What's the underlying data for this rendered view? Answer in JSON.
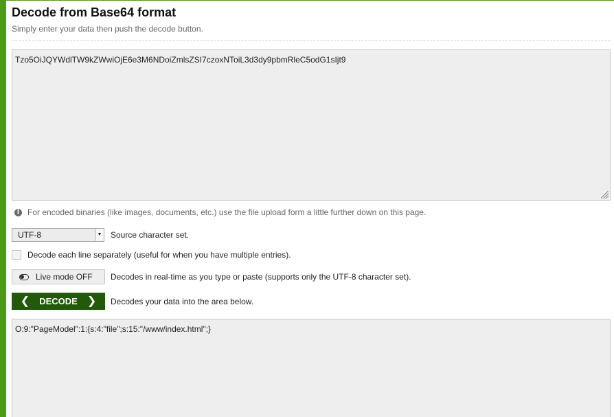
{
  "header": {
    "title": "Decode from Base64 format",
    "subtitle": "Simply enter your data then push the decode button."
  },
  "input": {
    "value": "Tzo5OiJQYWdlTW9kZWwiOjE6e3M6NDoiZmlsZSI7czoxNToiL3d3dy9pbmRleC5odG1sIjt9"
  },
  "info": {
    "text": "For encoded binaries (like images, documents, etc.) use the file upload form a little further down on this page."
  },
  "charset": {
    "selected": "UTF-8",
    "label": "Source character set."
  },
  "line_option": {
    "label": "Decode each line separately (useful for when you have multiple entries)."
  },
  "live_mode": {
    "button_label": "Live mode OFF",
    "description": "Decodes in real-time as you type or paste (supports only the UTF-8 character set)."
  },
  "decode": {
    "button_label": "DECODE",
    "description": "Decodes your data into the area below."
  },
  "output": {
    "value": "O:9:\"PageModel\":1:{s:4:\"file\";s:15:\"/www/index.html\";}"
  },
  "colors": {
    "accent": "#4f9a14",
    "button_dark": "#22590a"
  },
  "icons": {
    "info": "info-icon",
    "toggle": "toggle-off-icon",
    "chevron_left": "chevron-left-icon",
    "chevron_right": "chevron-right-icon",
    "dropdown": "dropdown-arrow-icon"
  }
}
